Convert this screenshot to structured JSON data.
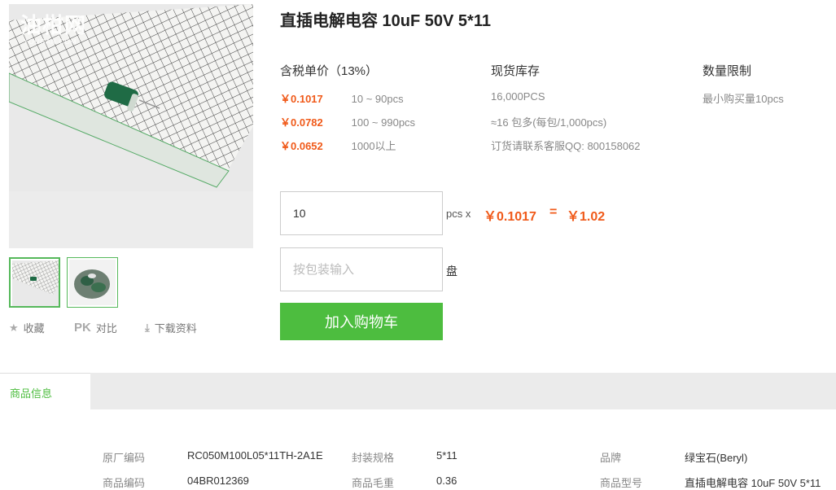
{
  "product": {
    "title": "直插电解电容 10uF 50V 5*11",
    "watermark": "油柑网",
    "watermark_sub": "YOUGAN.COM"
  },
  "pricing": {
    "header": "含税单价（13%）",
    "tiers": [
      {
        "price": "￥0.1017",
        "range": "10 ~ 90pcs"
      },
      {
        "price": "￥0.0782",
        "range": "100 ~ 990pcs"
      },
      {
        "price": "￥0.0652",
        "range": "1000以上"
      }
    ]
  },
  "stock": {
    "header": "现货库存",
    "lines": [
      "16,000PCS",
      "≈16 包多(每包/1,000pcs)",
      "订货请联系客服QQ: 800158062"
    ]
  },
  "limit": {
    "header": "数量限制",
    "text": "最小购买量10pcs"
  },
  "order": {
    "quantity_value": "10",
    "unit_pcs": "pcs x",
    "unit_price": "￥0.1017",
    "equals": "=",
    "total": "￥1.02",
    "pack_placeholder": "按包装输入",
    "pack_unit": "盘",
    "add_to_cart": "加入购物车"
  },
  "actions": {
    "favorite": "收藏",
    "pk_icon": "PK",
    "compare": "对比",
    "download": "下载资料"
  },
  "tabs": {
    "active": "商品信息"
  },
  "specs": [
    {
      "label": "原厂编码",
      "value": "RC050M100L05*11TH-2A1E"
    },
    {
      "label": "封装规格",
      "value": "5*11"
    },
    {
      "label": "品牌",
      "value": "绿宝石(Beryl)"
    },
    {
      "label": "商品编码",
      "value": "04BR012369"
    },
    {
      "label": "商品毛重",
      "value": "0.36"
    },
    {
      "label": "商品型号",
      "value": "直插电解电容 10uF 50V 5*11"
    }
  ],
  "icons": {
    "favorite": "star-icon",
    "download": "download-icon"
  },
  "colors": {
    "accent_green": "#4dbd3f",
    "price_orange": "#f05a1a"
  }
}
